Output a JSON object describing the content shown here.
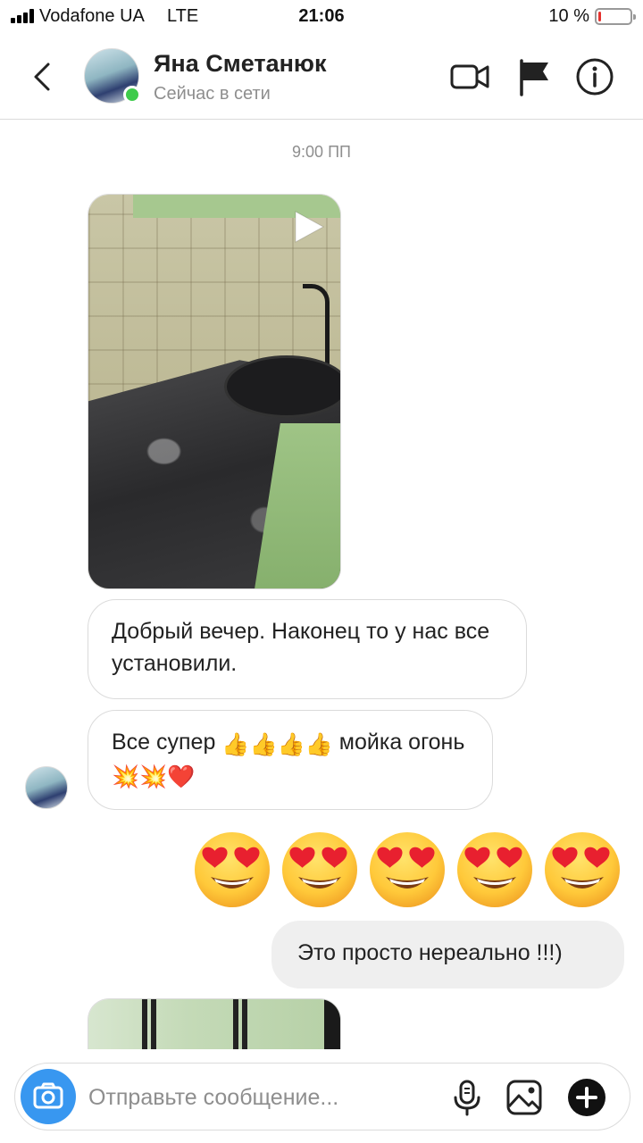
{
  "status_bar": {
    "carrier": "Vodafone UA",
    "network": "LTE",
    "time": "21:06",
    "battery": "10 %",
    "battery_level": 0.1
  },
  "header": {
    "contact_name": "Яна Сметанюк",
    "presence": "Сейчас в сети",
    "icons": [
      "back-chevron-icon",
      "video-call-icon",
      "flag-icon",
      "info-icon"
    ]
  },
  "chat": {
    "timestamp": "9:00 ПП",
    "messages": [
      {
        "type": "video",
        "sender": "contact"
      },
      {
        "type": "text",
        "sender": "contact",
        "text": "Добрый вечер. Наконец то у нас все установили."
      },
      {
        "type": "text",
        "sender": "contact",
        "text_before": "Все супер ",
        "emoji_thumbs": "👍👍👍👍",
        "text_middle": " мойка огонь ",
        "emoji_end": "💥💥❤️"
      },
      {
        "type": "emoji",
        "sender": "me",
        "emoji": "😍😍😍😍😍"
      },
      {
        "type": "text",
        "sender": "me",
        "text": "Это просто нереально !!!)"
      },
      {
        "type": "video",
        "sender": "contact"
      }
    ]
  },
  "composer": {
    "placeholder": "Отправьте сообщение...",
    "icons": [
      "camera-icon",
      "microphone-icon",
      "gallery-icon",
      "plus-icon"
    ]
  },
  "colors": {
    "accent_blue": "#3897f0",
    "online_green": "#3ecb4b",
    "battery_red": "#e5322e",
    "bubble_border": "#dbdbdb",
    "own_bubble": "#efefef",
    "muted_text": "#8e8e8e"
  }
}
